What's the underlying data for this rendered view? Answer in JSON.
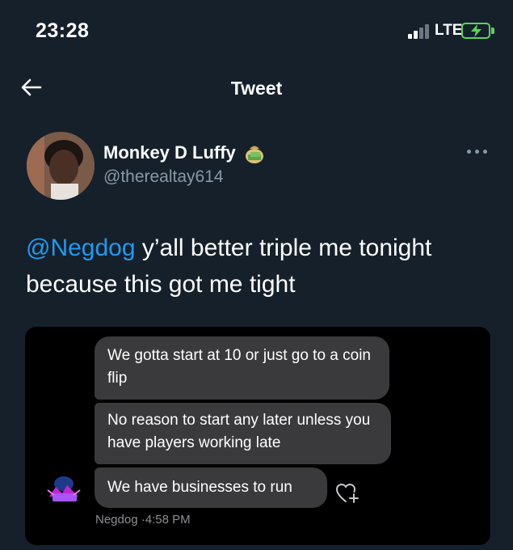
{
  "status": {
    "time": "23:28",
    "network": "LTE",
    "battery_color": "#58d657"
  },
  "nav": {
    "back_icon": "arrow-left-icon",
    "title": "Tweet"
  },
  "tweet": {
    "display_name": "Monkey D Luffy",
    "name_emoji": "money-bag-emoji",
    "handle": "@therealtay614",
    "mention": "@Negdog",
    "text_rest": " y’all better triple me tonight because this got me tight",
    "more_icon": "more-horizontal-icon"
  },
  "media": {
    "messages": [
      "We gotta start at 10 or just go to a coin flip",
      "No reason to start any later unless you have players working late",
      "We have businesses to run"
    ],
    "sender": "Negdog",
    "time": "4:58 PM",
    "meta_separator": "·",
    "react_icon": "heart-plus-icon"
  },
  "colors": {
    "background": "#15202b",
    "accent": "#1d9bf0",
    "muted": "#8899a6",
    "bubble": "#3a3a3c"
  }
}
